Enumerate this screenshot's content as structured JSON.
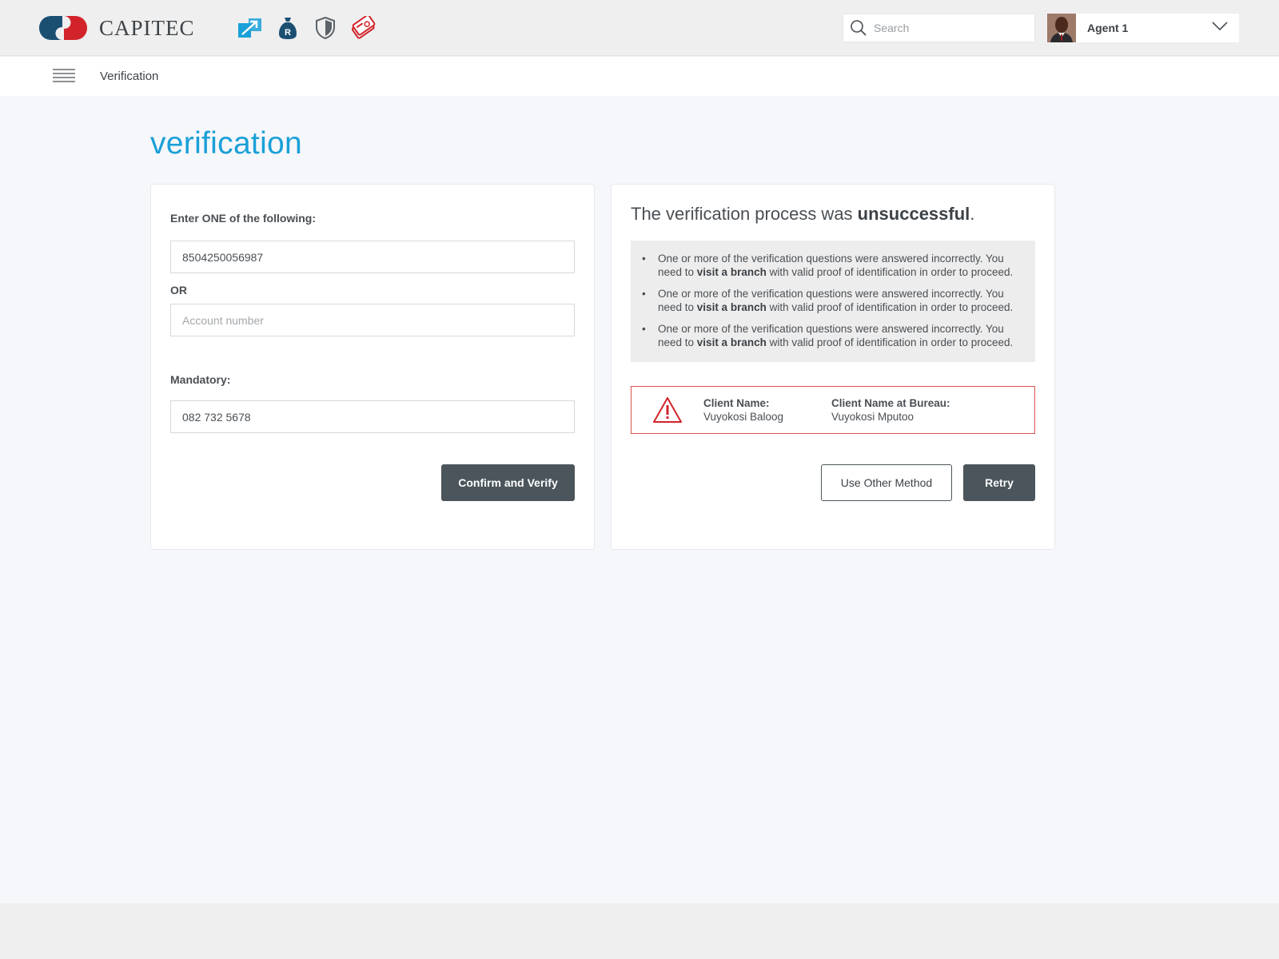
{
  "header": {
    "brand": "CAPITEC",
    "colors": {
      "brand_red": "#d2232a",
      "brand_navy": "#1b4f72",
      "accent_blue": "#1aa0d8"
    },
    "app_icons": [
      "transfer-icon",
      "money-bag-icon",
      "shield-icon",
      "card-icon"
    ],
    "search": {
      "placeholder": "Search"
    },
    "agent": {
      "name": "Agent 1"
    }
  },
  "subheader": {
    "title": "Verification"
  },
  "page": {
    "title": "verification"
  },
  "left_card": {
    "label_one_of": "Enter ONE of the following:",
    "id_number_value": "8504250056987",
    "or_label": "OR",
    "account_placeholder": "Account number",
    "mandatory_label": "Mandatory:",
    "phone_value": "082 732 5678",
    "confirm_button": "Confirm and Verify"
  },
  "right_card": {
    "heading_prefix": "The verification process was ",
    "heading_emphasis": "unsuccessful",
    "heading_suffix": ".",
    "messages": [
      {
        "before": "One or more of the verification questions were answered incorrectly. You need to ",
        "bold": "visit a branch",
        "after": " with valid proof of identification in order to proceed."
      },
      {
        "before": "One or more of the verification questions were answered incorrectly. You need to ",
        "bold": "visit a branch",
        "after": " with valid proof of identification in order to proceed."
      },
      {
        "before": "One or more of the verification questions were answered incorrectly. You need to ",
        "bold": "visit a branch",
        "after": " with valid proof of identification in order to proceed."
      }
    ],
    "alert": {
      "client_name_label": "Client Name:",
      "client_name_value": "Vuyokosi Baloog",
      "bureau_name_label": "Client Name at Bureau:",
      "bureau_name_value": "Vuyokosi Mputoo"
    },
    "other_method_button": "Use Other Method",
    "retry_button": "Retry"
  }
}
